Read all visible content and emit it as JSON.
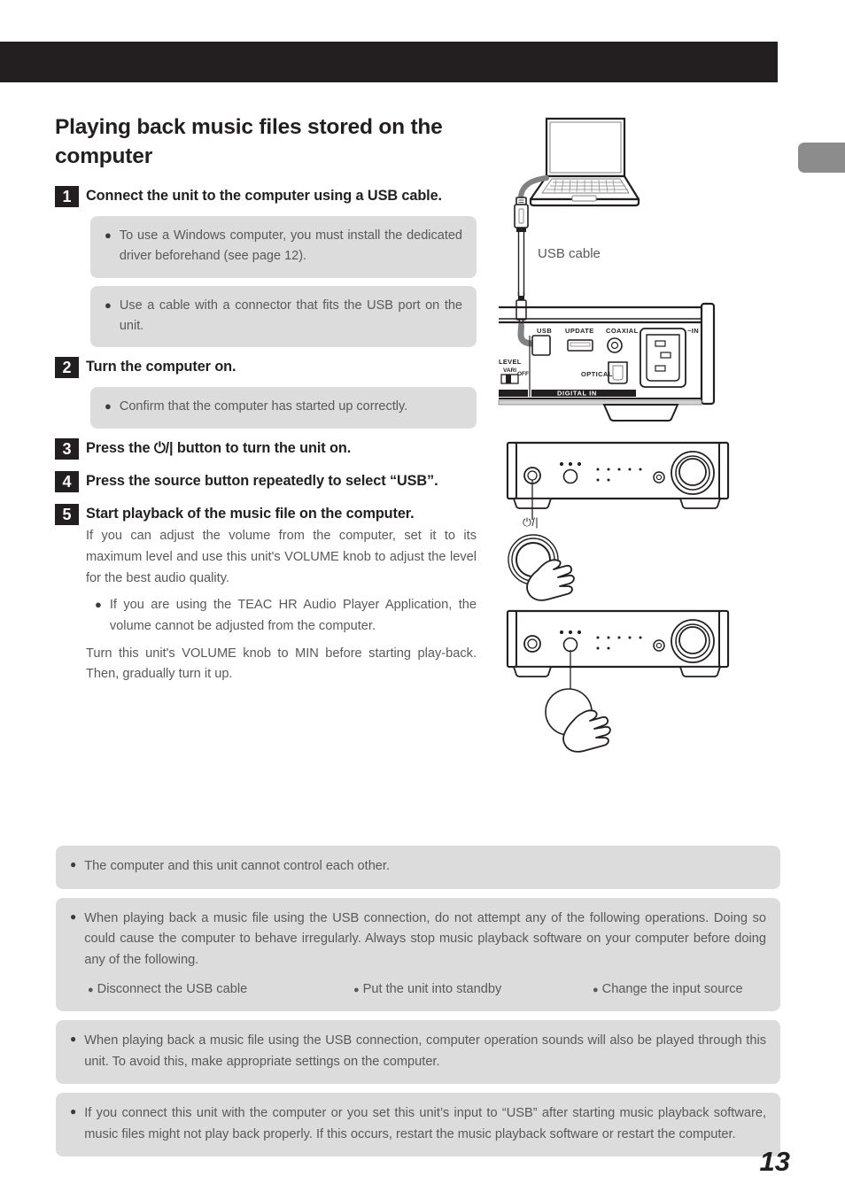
{
  "page": {
    "number": "13"
  },
  "heading": {
    "title": "Playing back music files stored on the computer"
  },
  "steps": [
    {
      "num": "1",
      "text": "Connect the unit to the computer using a USB cable.",
      "notes": [
        "To use a Windows computer, you must install the dedicated driver beforehand (see page 12).",
        "Use a cable with a connector that fits the USB port on the unit."
      ]
    },
    {
      "num": "2",
      "text": "Turn the computer on.",
      "notes": [
        "Confirm that the computer has started up correctly."
      ]
    },
    {
      "num": "3",
      "text": "Press the ⏻/| button to turn the unit on.",
      "notes": []
    },
    {
      "num": "4",
      "text": "Press the source button repeatedly to select “USB”.",
      "notes": []
    },
    {
      "num": "5",
      "text": "Start playback of the music file on the computer.",
      "body_1": "If you can adjust the volume from the computer, set it to its maximum level and use this unit's VOLUME knob to adjust the level for the best audio quality.",
      "bullet_1": "If you are using the TEAC HR Audio Player Application, the volume cannot be adjusted from the computer.",
      "body_2": "Turn this unit's VOLUME knob to MIN before starting play-back. Then, gradually turn it up."
    }
  ],
  "illustration": {
    "usb_cable_label": "USB cable",
    "power_symbol_label": "⏻/|",
    "rear_panel": {
      "usb": "USB",
      "update": "UPDATE",
      "coaxial": "COAXIAL",
      "ac_in": "~IN",
      "optical": "OPTICAL",
      "digital_in": "DIGITAL IN",
      "level": "LEVEL",
      "vari": "VARI",
      "off": "OFF"
    }
  },
  "bottom_notes": [
    {
      "text": "The computer and this unit cannot control each other.",
      "sub_bullets": []
    },
    {
      "text": "When playing back a music file using the USB connection, do not attempt any of the following operations. Doing so could cause the computer to behave irregularly. Always stop music playback software on your computer before doing any of the following.",
      "sub_bullets": [
        "Disconnect the USB cable",
        "Put the unit into standby",
        "Change the input source"
      ]
    },
    {
      "text": "When playing back a music file using the USB connection, computer operation sounds will also be played through this unit. To avoid this, make appropriate settings on the computer.",
      "sub_bullets": []
    },
    {
      "text": "If you connect this unit with the computer or you set this unit’s input to “USB” after starting music playback software, music files might not play back properly. If this occurs, restart the music playback software or restart the computer.",
      "sub_bullets": []
    }
  ]
}
